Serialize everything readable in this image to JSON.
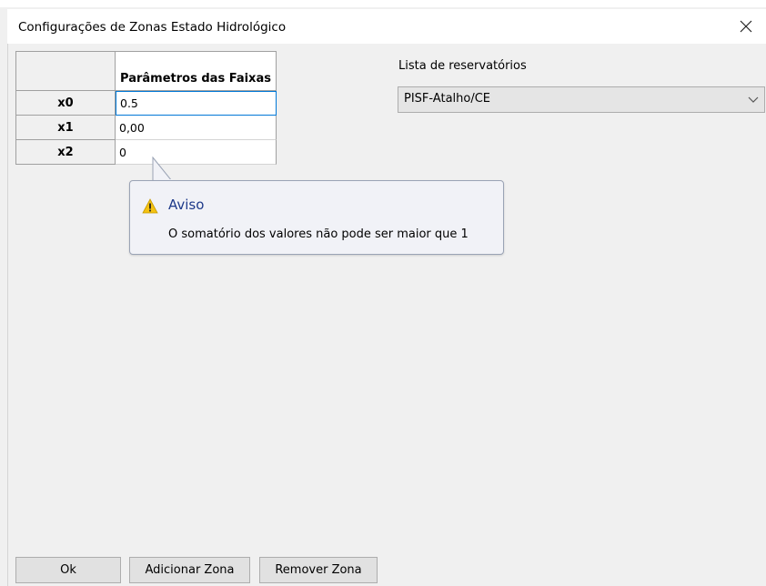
{
  "window": {
    "title": "Configurações de Zonas Estado Hidrológico",
    "close_glyph": "✕"
  },
  "grid": {
    "column_header": "Parâmetros das Faixas",
    "rows": [
      {
        "label": "x0",
        "value": "0.5"
      },
      {
        "label": "x1",
        "value": "0,00"
      },
      {
        "label": "x2",
        "value": "0"
      }
    ]
  },
  "reservoirs": {
    "label": "Lista de reservatórios",
    "selected": "PISF-Atalho/CE",
    "dropdown_icon": "chevron-down-icon"
  },
  "tooltip": {
    "title": "Aviso",
    "message": "O somatório dos valores não pode ser maior que 1",
    "icon": "warning-icon",
    "title_color": "#1e3a8a",
    "icon_color": "#f5c211"
  },
  "buttons": {
    "ok": "Ok",
    "add_zone": "Adicionar Zona",
    "remove_zone": "Remover Zona"
  }
}
